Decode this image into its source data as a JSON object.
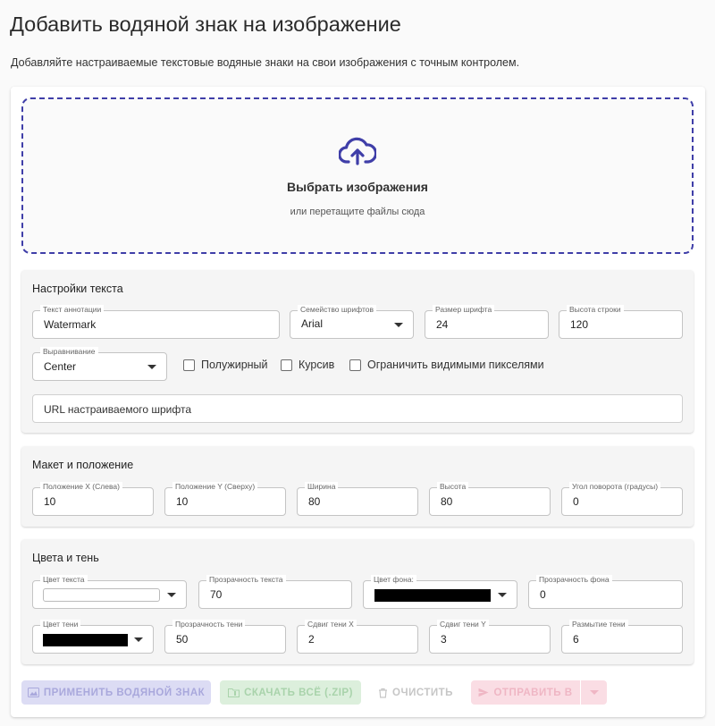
{
  "header": {
    "title": "Добавить водяной знак на изображение",
    "subtitle": "Добавляйте настраиваемые текстовые водяные знаки на свои изображения с точным контролем."
  },
  "dropzone": {
    "icon": "cloud-upload-icon",
    "title": "Выбрать изображения",
    "hint": "или перетащите файлы сюда",
    "accent_color": "#3f3ea8"
  },
  "text_settings": {
    "title": "Настройки текста",
    "annotation_text": {
      "label": "Текст аннотации",
      "value": "Watermark"
    },
    "font_family": {
      "label": "Семейство шрифтов",
      "value": "Arial"
    },
    "font_size": {
      "label": "Размер шрифта",
      "value": "24"
    },
    "line_height": {
      "label": "Высота строки",
      "value": "120"
    },
    "alignment": {
      "label": "Выравнивание",
      "value": "Center"
    },
    "bold": {
      "label": "Полужирный",
      "checked": false
    },
    "italic": {
      "label": "Курсив",
      "checked": false
    },
    "limit_visible": {
      "label": "Ограничить видимыми пикселями",
      "checked": false
    },
    "custom_font_url": {
      "placeholder": "URL настраиваемого шрифта"
    }
  },
  "layout": {
    "title": "Макет и положение",
    "pos_x": {
      "label": "Положение X (Слева)",
      "value": "10"
    },
    "pos_y": {
      "label": "Положение Y (Сверху)",
      "value": "10"
    },
    "width": {
      "label": "Ширина",
      "value": "80"
    },
    "height": {
      "label": "Высота",
      "value": "80"
    },
    "rotation": {
      "label": "Угол поворота (градусы)",
      "value": "0"
    }
  },
  "colors": {
    "title": "Цвета и тень",
    "text_color": {
      "label": "Цвет текста",
      "color": "#ffffff"
    },
    "text_opacity": {
      "label": "Прозрачность текста",
      "value": "70"
    },
    "bg_color": {
      "label": "Цвет фона:",
      "color": "#000000"
    },
    "bg_opacity": {
      "label": "Прозрачность фона",
      "value": "0"
    },
    "shadow_color": {
      "label": "Цвет тени",
      "color": "#000000"
    },
    "shadow_opacity": {
      "label": "Прозрачность тени",
      "value": "50"
    },
    "shadow_x": {
      "label": "Сдвиг тени X",
      "value": "2"
    },
    "shadow_y": {
      "label": "Сдвиг тени Y",
      "value": "3"
    },
    "shadow_blur": {
      "label": "Размытие тени",
      "value": "6"
    }
  },
  "actions": {
    "apply": {
      "label": "ПРИМЕНИТЬ ВОДЯНОЙ ЗНАК",
      "icon": "image-icon",
      "enabled": false
    },
    "download_zip": {
      "label": "СКАЧАТЬ ВСЁ (.ZIP)",
      "icon": "folder-zip-icon",
      "enabled": false
    },
    "clear": {
      "label": "ОЧИСТИТЬ",
      "icon": "trash-icon",
      "enabled": false
    },
    "send_to": {
      "label": "ОТПРАВИТЬ В",
      "icon": "send-icon",
      "enabled": false
    }
  }
}
